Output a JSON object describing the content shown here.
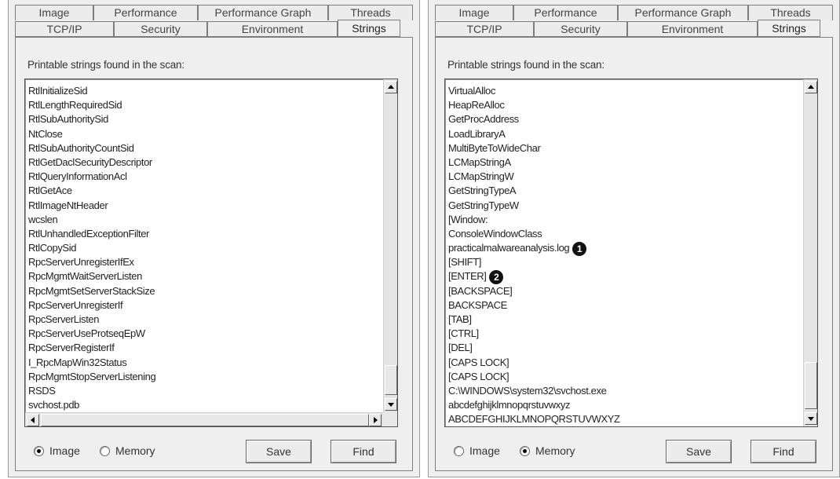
{
  "tabs_back": [
    "Image",
    "Performance",
    "Performance Graph",
    "Threads"
  ],
  "tabs_front": [
    "TCP/IP",
    "Security",
    "Environment",
    "Strings"
  ],
  "active_tab": "Strings",
  "caption": "Printable strings found in the scan:",
  "left": {
    "strings": [
      "RtlInitializeSid",
      "RtlLengthRequiredSid",
      "RtlSubAuthoritySid",
      "NtClose",
      "RtlSubAuthorityCountSid",
      "RtlGetDaclSecurityDescriptor",
      "RtlQueryInformationAcl",
      "RtlGetAce",
      "RtlImageNtHeader",
      "wcslen",
      "RtlUnhandledExceptionFilter",
      "RtlCopySid",
      "RpcServerUnregisterIfEx",
      "RpcMgmtWaitServerListen",
      "RpcMgmtSetServerStackSize",
      "RpcServerUnregisterIf",
      "RpcServerListen",
      "RpcServerUseProtseqEpW",
      "RpcServerRegisterIf",
      "I_RpcMapWin32Status",
      "RpcMgmtStopServerListening",
      "RSDS",
      "svchost.pdb"
    ],
    "radio_image": "Image",
    "radio_memory": "Memory",
    "selected": "Image",
    "save": "Save",
    "find": "Find"
  },
  "right": {
    "strings": [
      "VirtualAlloc",
      "HeapReAlloc",
      "GetProcAddress",
      "LoadLibraryA",
      "MultiByteToWideChar",
      "LCMapStringA",
      "LCMapStringW",
      "GetStringTypeA",
      "GetStringTypeW",
      "[Window:",
      "ConsoleWindowClass",
      "practicalmalwareanalysis.log",
      "[SHIFT]",
      "[ENTER]",
      "[BACKSPACE]",
      "BACKSPACE",
      "[TAB]",
      "[CTRL]",
      "[DEL]",
      "[CAPS LOCK]",
      "[CAPS LOCK]",
      "C:\\WINDOWS\\system32\\svchost.exe",
      "abcdefghijklmnopqrstuvwxyz",
      "ABCDEFGHIJKLMNOPQRSTUVWXYZ"
    ],
    "marker_1": "1",
    "marker_2": "2",
    "radio_image": "Image",
    "radio_memory": "Memory",
    "selected": "Memory",
    "save": "Save",
    "find": "Find"
  },
  "colors": {
    "panel_bg": "#efefef",
    "list_bg": "#ffffff",
    "border": "#7d7d7d"
  }
}
